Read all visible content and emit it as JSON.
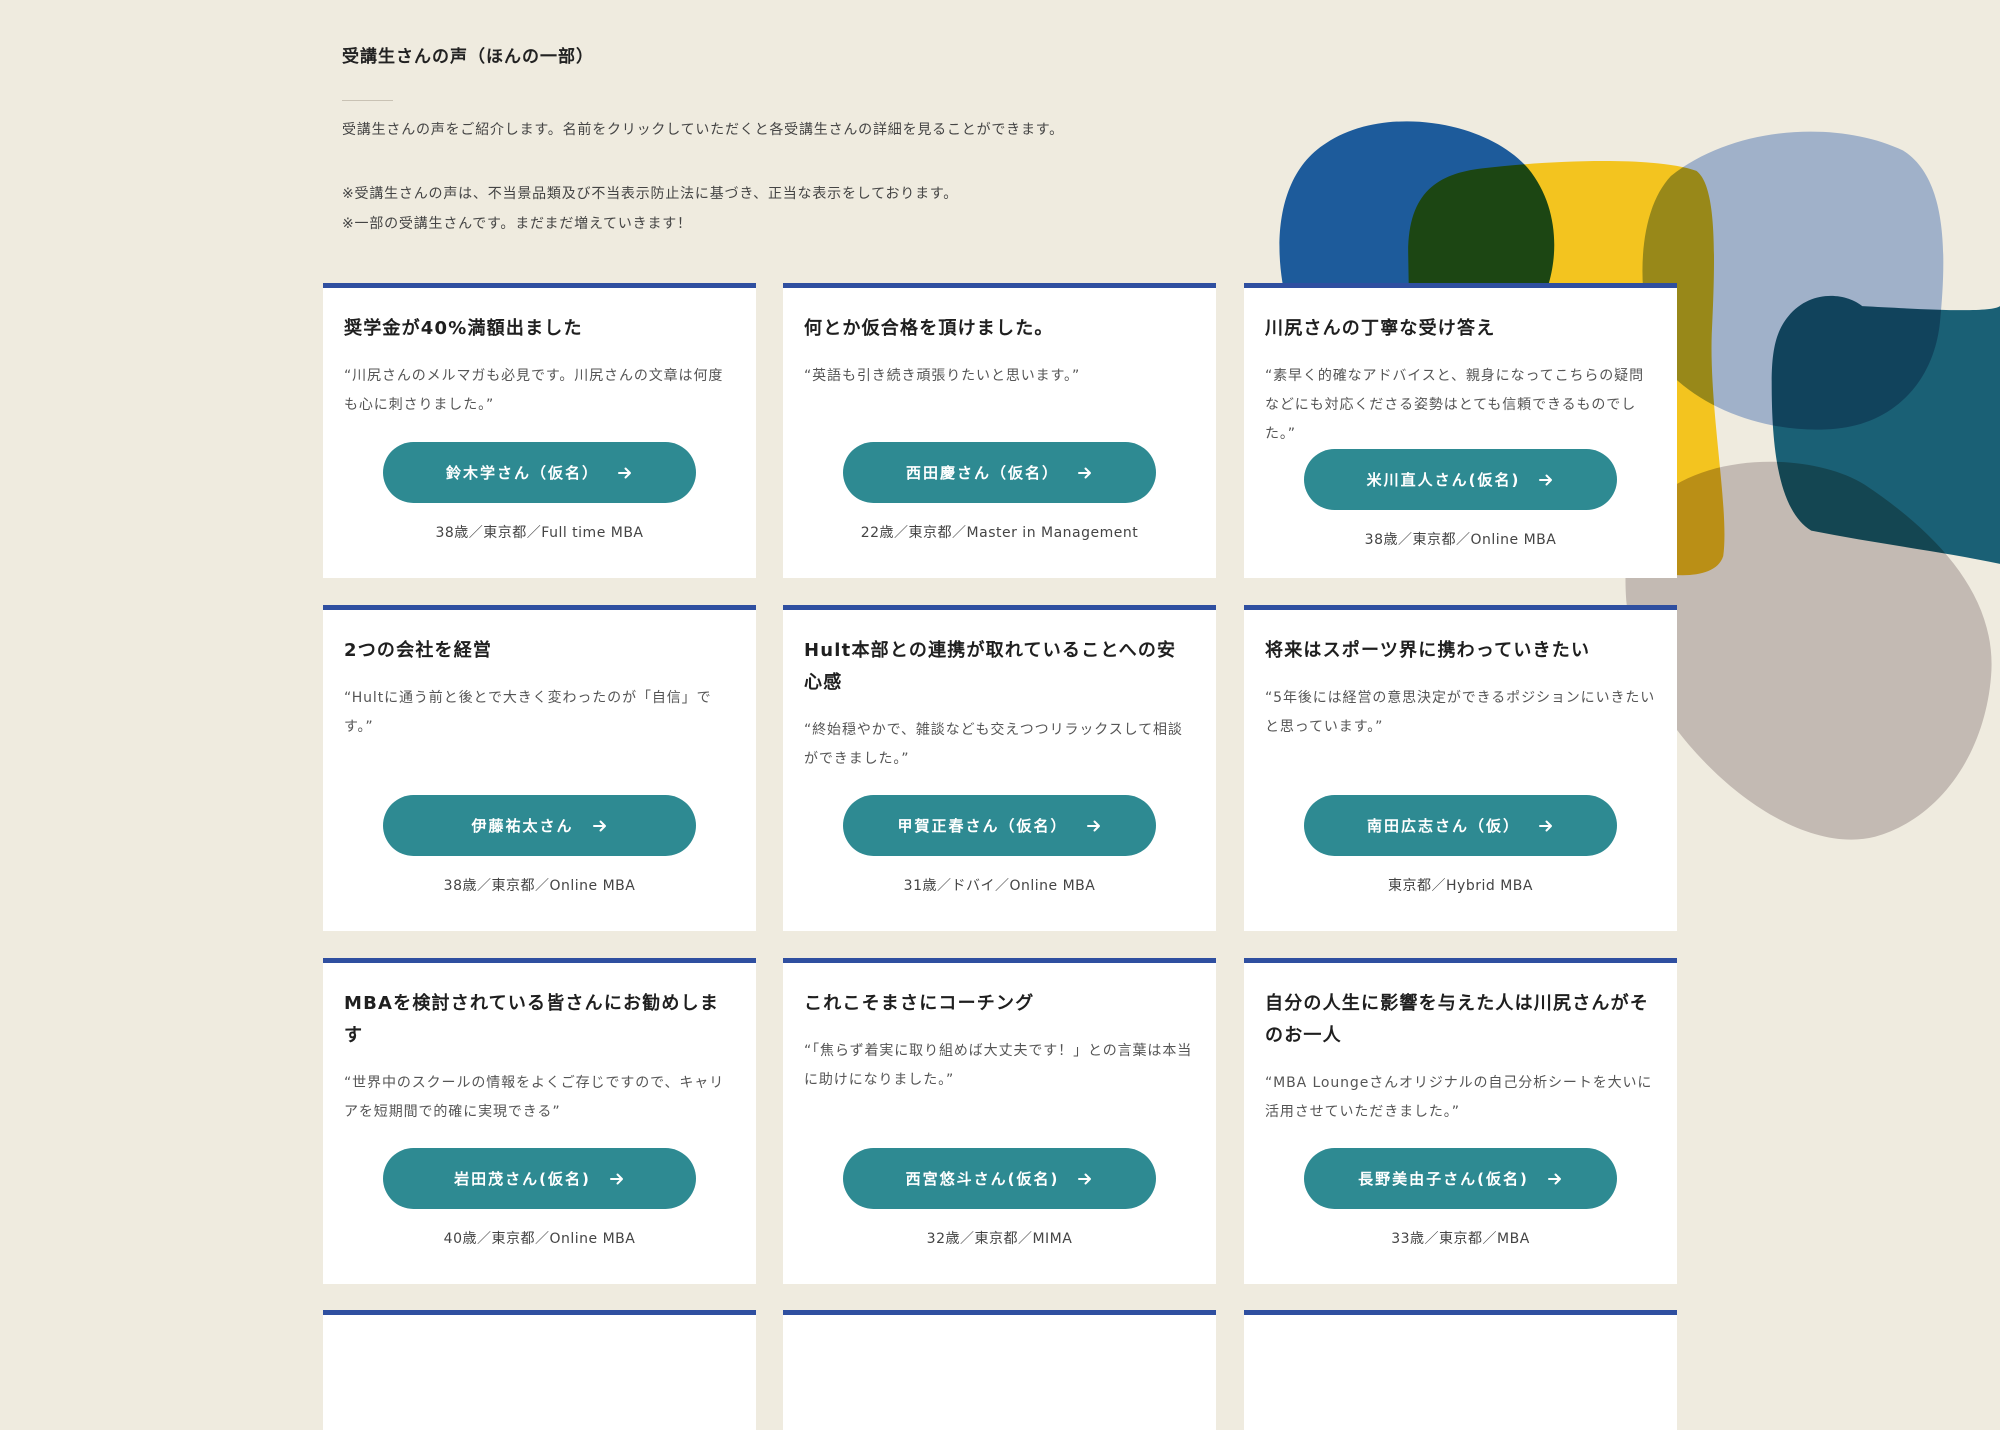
{
  "section": {
    "title": "受講生さんの声（ほんの一部）",
    "intro": "受講生さんの声をご紹介します。名前をクリックしていただくと各受講生さんの詳細を見ることができます。",
    "notes": [
      "※受講生さんの声は、不当景品類及び不当表示防止法に基づき、正当な表示をしております。",
      "※一部の受講生さんです。まだまだ増えていきます！"
    ]
  },
  "cards": [
    {
      "title": "奨学金が40%満額出ました",
      "quote": "“川尻さんのメルマガも必見です。川尻さんの文章は何度も心に刺さりました。”",
      "button": "鈴木学さん（仮名）",
      "meta": "38歳／東京都／Full time MBA"
    },
    {
      "title": "何とか仮合格を頂けました。",
      "quote": "“英語も引き続き頑張りたいと思います。”",
      "button": "西田慶さん（仮名）",
      "meta": "22歳／東京都／Master in Management"
    },
    {
      "title": "川尻さんの丁寧な受け答え",
      "quote": "“素早く的確なアドバイスと、親身になってこちらの疑問などにも対応くださる姿勢はとても信頼できるものでした。”",
      "button": "米川直人さん(仮名)",
      "meta": "38歳／東京都／Online MBA"
    },
    {
      "title": "2つの会社を経営",
      "quote": "“Hultに通う前と後とで大きく変わったのが「自信」です。”",
      "button": "伊藤祐太さん",
      "meta": "38歳／東京都／Online MBA"
    },
    {
      "title": "Hult本部との連携が取れていることへの安心感",
      "quote": "“終始穏やかで、雑談なども交えつつリラックスして相談ができました。”",
      "button": "甲賀正春さん（仮名）",
      "meta": "31歳／ドバイ／Online MBA"
    },
    {
      "title": "将来はスポーツ界に携わっていきたい",
      "quote": "“5年後には経営の意思決定ができるポジションにいきたいと思っています。”",
      "button": "南田広志さん（仮）",
      "meta": "東京都／Hybrid MBA"
    },
    {
      "title": "MBAを検討されている皆さんにお勧めします",
      "quote": "“世界中のスクールの情報をよくご存じですので、キャリアを短期間で的確に実現できる”",
      "button": "岩田茂さん(仮名)",
      "meta": "40歳／東京都／Online MBA"
    },
    {
      "title": "これこそまさにコーチング",
      "quote": "“「焦らず着実に取り組めば大丈夫です！」との言葉は本当に助けになりました。”",
      "button": "西宮悠斗さん(仮名)",
      "meta": "32歳／東京都／MIMA"
    },
    {
      "title": "自分の人生に影響を与えた人は川尻さんがそのお一人",
      "quote": "“MBA Loungeさんオリジナルの自己分析シートを大いに活用させていただきました。”",
      "button": "長野美由子さん(仮名)",
      "meta": "33歳／東京都／MBA"
    }
  ],
  "icons": {
    "button_arrow": "arrow-right-icon"
  },
  "colors": {
    "background": "#efebdf",
    "card_border": "#2f4fa0",
    "button": "#2e8a92",
    "blob_blue": "#1d5b9b",
    "blob_yellow": "#f3c41f",
    "blob_grayblue": "#a0b1c9",
    "blob_teal": "#1a6075",
    "blob_gray": "#c3bab3"
  }
}
